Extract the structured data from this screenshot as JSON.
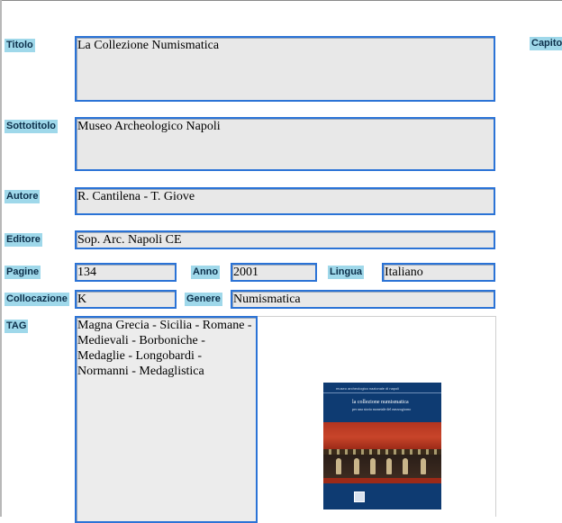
{
  "form": {
    "labels": {
      "titolo": "Titolo",
      "capitolo_partial": "Capito",
      "sottotitolo": "Sottotitolo",
      "autore": "Autore",
      "editore": "Editore",
      "pagine": "Pagine",
      "anno": "Anno",
      "lingua": "Lingua",
      "collocazione": "Collocazione",
      "genere": "Genere",
      "tag": "TAG"
    },
    "values": {
      "titolo": "La Collezione Numismatica",
      "sottotitolo": "Museo Archeologico Napoli",
      "autore": "R. Cantilena - T. Giove",
      "editore": "Sop. Arc. Napoli CE",
      "pagine": "134",
      "anno": "2001",
      "lingua": "Italiano",
      "collocazione": "K",
      "genere": "Numismatica",
      "tag": "Magna Grecia - Sicilia - Romane - Medievali - Borboniche - Medaglie - Longobardi - Normanni - Medaglistica"
    }
  },
  "cover": {
    "publisher_line": "museo archeologico nazionale di napoli",
    "title": "la collezione numismatica",
    "subtitle": "per una storia monetale del mezzogiorno",
    "colors": {
      "background": "#0e3b72",
      "fresco_red": "#b3341f"
    }
  }
}
